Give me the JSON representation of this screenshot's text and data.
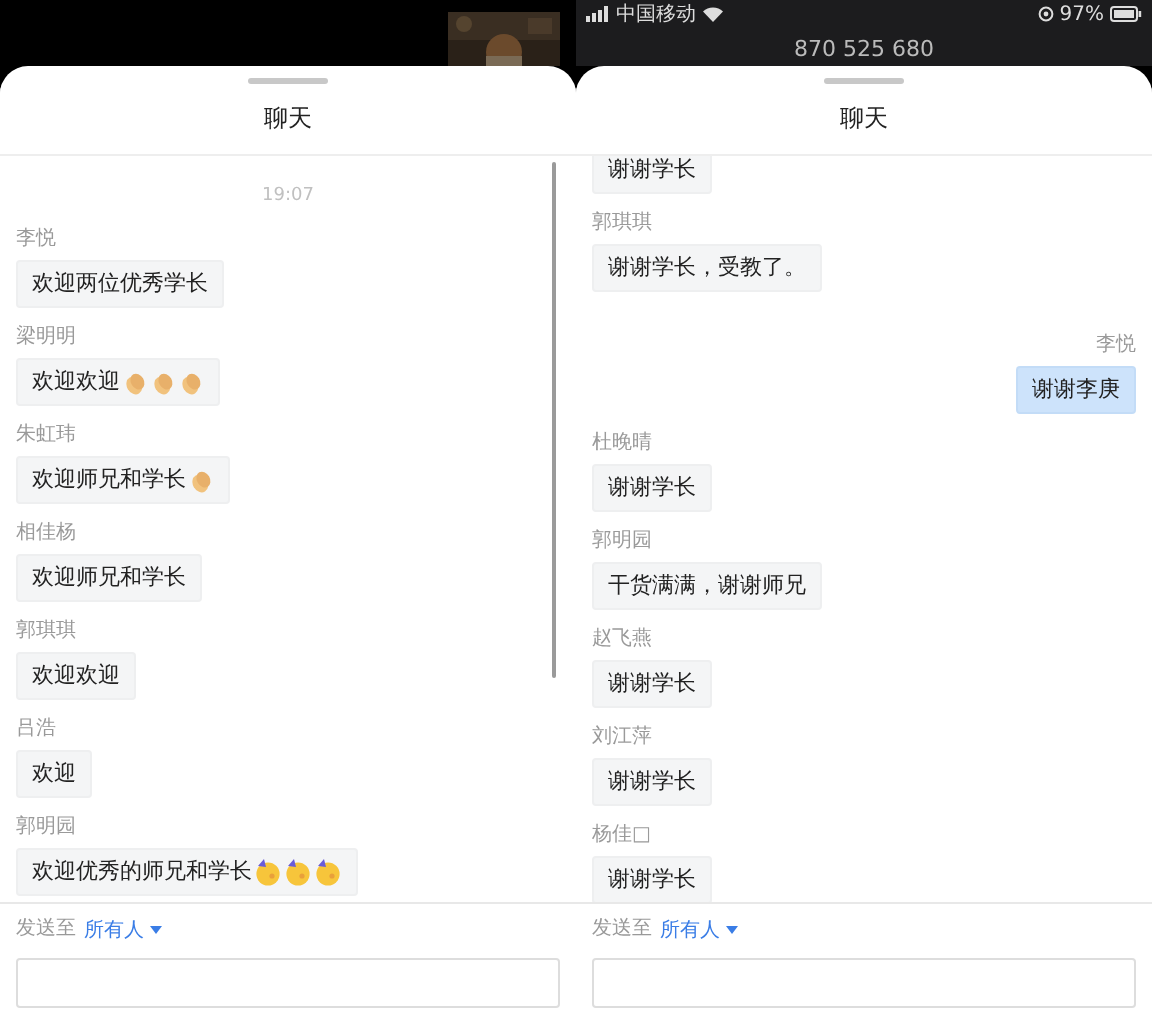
{
  "panels": [
    {
      "backdrop": {
        "kind": "thumbnail"
      },
      "title": "聊天",
      "time": "19:07",
      "scrolled": false,
      "scrollbar_visible": true,
      "messages": [
        {
          "kind": "other",
          "name": "李悦",
          "text": "欢迎两位优秀学长"
        },
        {
          "kind": "other",
          "name": "梁明明",
          "text": "欢迎欢迎",
          "emojis": [
            {
              "kind": "clap"
            },
            {
              "kind": "clap"
            },
            {
              "kind": "clap"
            }
          ]
        },
        {
          "kind": "other",
          "name": "朱虹玮",
          "text": "欢迎师兄和学长",
          "emojis": [
            {
              "kind": "clap"
            }
          ]
        },
        {
          "kind": "other",
          "name": "相佳杨",
          "text": "欢迎师兄和学长"
        },
        {
          "kind": "other",
          "name": "郭琪琪",
          "text": "欢迎欢迎"
        },
        {
          "kind": "other",
          "name": "吕浩",
          "text": "欢迎"
        },
        {
          "kind": "other",
          "name": "郭明园",
          "text": "欢迎优秀的师兄和学长",
          "emojis": [
            {
              "kind": "party"
            },
            {
              "kind": "party"
            },
            {
              "kind": "party"
            }
          ]
        }
      ],
      "footer": {
        "label": "发送至",
        "recipient": "所有人"
      }
    },
    {
      "backdrop": {
        "kind": "status",
        "carrier": "中国移动",
        "battery": "97%",
        "caption": "870 525 680"
      },
      "title": "聊天",
      "scrolled": true,
      "messages": [
        {
          "kind": "other",
          "text": "谢谢学长"
        },
        {
          "kind": "other",
          "name": "郭琪琪",
          "text": "谢谢学长，受教了。"
        },
        {
          "kind": "self",
          "name": "李悦",
          "text": "谢谢李庚"
        },
        {
          "kind": "other",
          "name": "杜晚晴",
          "text": "谢谢学长"
        },
        {
          "kind": "other",
          "name": "郭明园",
          "text": "干货满满，谢谢师兄"
        },
        {
          "kind": "other",
          "name": "赵飞燕",
          "text": "谢谢学长"
        },
        {
          "kind": "other",
          "name": "刘江萍",
          "text": "谢谢学长"
        },
        {
          "kind": "other",
          "name": "杨佳□",
          "text": "谢谢学长"
        }
      ],
      "footer": {
        "label": "发送至",
        "recipient": "所有人"
      }
    }
  ]
}
